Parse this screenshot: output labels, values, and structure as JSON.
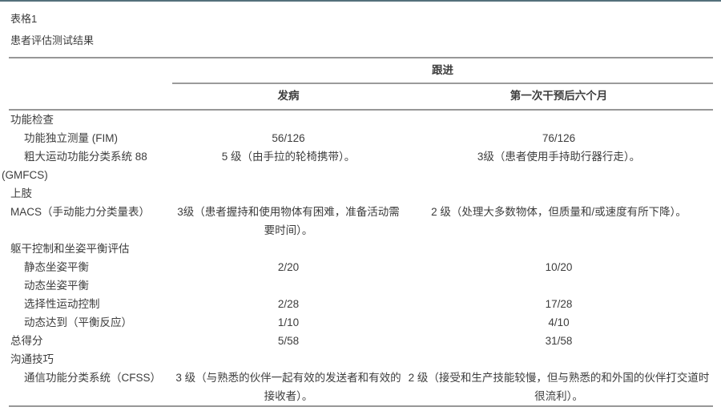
{
  "table": {
    "number": "表格1",
    "caption": "患者评估测试结果",
    "header": {
      "span_label": "跟进",
      "col_onset": "发病",
      "col_six_months": "第一次干预后六个月"
    },
    "rows": [
      {
        "label": "功能检查",
        "c1": "",
        "c2": ""
      },
      {
        "label": "功能独立测量 (FIM)",
        "c1": "56/126",
        "c2": "76/126"
      },
      {
        "label": "粗大运动功能分类系统 88 (GMFCS)",
        "c1": "5 级（由手拉的轮椅携带）。",
        "c2": "3级（患者使用手持助行器行走）。"
      },
      {
        "label": "上肢",
        "c1": "",
        "c2": ""
      },
      {
        "label": "MACS（手动能力分类量表）",
        "c1": "3级（患者握持和使用物体有困难，准备活动需要时间）。",
        "c2": "2 级（处理大多数物体，但质量和/或速度有所下降）。"
      },
      {
        "label": "躯干控制和坐姿平衡评估",
        "c1": "",
        "c2": ""
      },
      {
        "label": "静态坐姿平衡",
        "c1": "2/20",
        "c2": "10/20"
      },
      {
        "label": "动态坐姿平衡",
        "c1": "",
        "c2": ""
      },
      {
        "label": "选择性运动控制",
        "c1": "2/28",
        "c2": "17/28"
      },
      {
        "label": "动态达到（平衡反应）",
        "c1": "1/10",
        "c2": "4/10"
      },
      {
        "label": "总得分",
        "c1": "5/58",
        "c2": "31/58"
      },
      {
        "label": "沟通技巧",
        "c1": "",
        "c2": ""
      },
      {
        "label": "通信功能分类系统（CFSS）",
        "c1": "3 级（与熟悉的伙伴一起有效的发送者和有效的接收者）。",
        "c2": "2 级（接受和生产技能较慢，但与熟悉的和外国的伙伴打交道时很流利）。"
      }
    ],
    "colors": {
      "accent_bar": "#54707b",
      "rule_gray": "#979797",
      "text": "#3d3d3d"
    }
  }
}
